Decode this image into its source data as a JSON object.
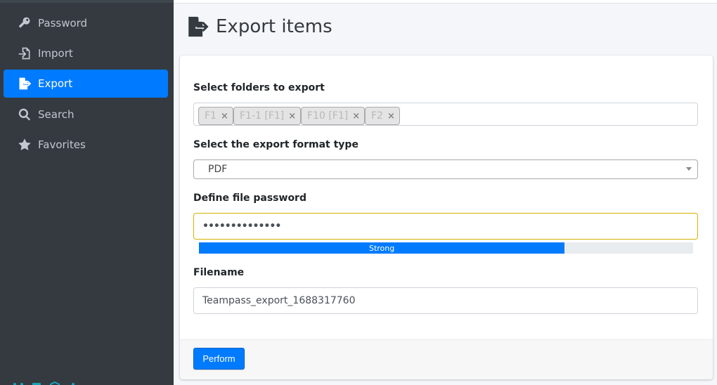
{
  "sidebar": {
    "items": [
      {
        "label": "Password",
        "icon": "key-icon",
        "active": false
      },
      {
        "label": "Import",
        "icon": "file-import-icon",
        "active": false
      },
      {
        "label": "Export",
        "icon": "file-export-icon",
        "active": true
      },
      {
        "label": "Search",
        "icon": "search-icon",
        "active": false
      },
      {
        "label": "Favorites",
        "icon": "star-icon",
        "active": false
      }
    ]
  },
  "header": {
    "title": "Export items",
    "icon": "file-export-icon"
  },
  "form": {
    "folders_label": "Select folders to export",
    "folders": [
      "F1",
      "F1-1 [F1]",
      "F10 [F1]",
      "F2"
    ],
    "remove_symbol": "×",
    "format_label": "Select the export format type",
    "format_value": "PDF",
    "password_label": "Define file password",
    "password_value": "••••••••••••••",
    "strength_label": "Strong",
    "strength_fraction": 0.74,
    "filename_label": "Filename",
    "filename_value": "Teampass_export_1688317760",
    "perform_label": "Perform"
  },
  "colors": {
    "sidebar_bg": "#343a40",
    "accent": "#007bff",
    "password_border": "#d4b200"
  }
}
